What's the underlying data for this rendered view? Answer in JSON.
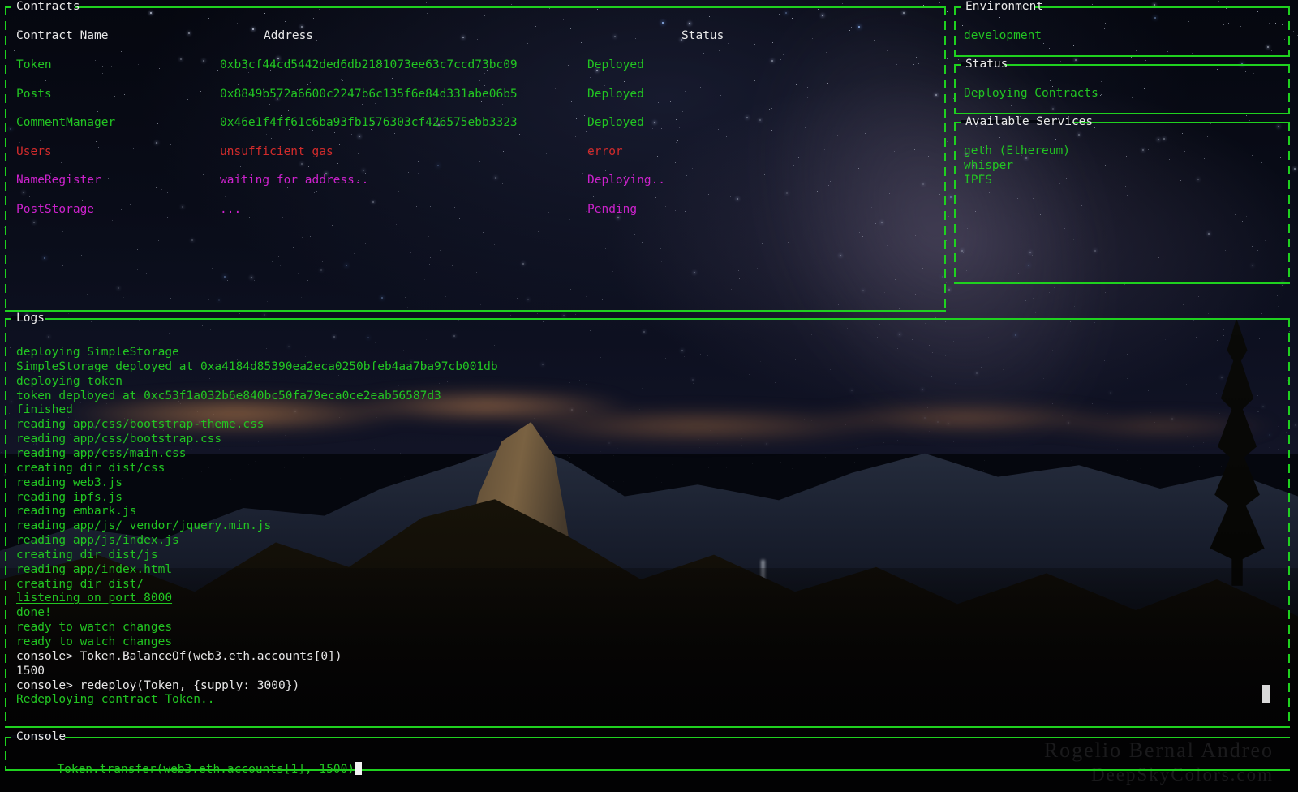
{
  "contracts_panel": {
    "title": "Contracts",
    "columns": [
      "Contract Name",
      "Address",
      "Status"
    ],
    "rows": [
      {
        "name": "Token",
        "address": "0xb3cf44cd5442ded6db2181073ee63c7ccd73bc09",
        "status": "Deployed",
        "color": "#22c522"
      },
      {
        "name": "Posts",
        "address": "0x8849b572a6600c2247b6c135f6e84d331abe06b5",
        "status": "Deployed",
        "color": "#22c522"
      },
      {
        "name": "CommentManager",
        "address": "0x46e1f4ff61c6ba93fb1576303cf426575ebb3323",
        "status": "Deployed",
        "color": "#22c522"
      },
      {
        "name": "Users",
        "address": "unsufficient gas",
        "status": "error",
        "color": "#d22b2b"
      },
      {
        "name": "NameRegister",
        "address": "waiting for address..",
        "status": "Deploying..",
        "color": "#cc22cc"
      },
      {
        "name": "PostStorage",
        "address": "...",
        "status": "Pending",
        "color": "#cc22cc"
      }
    ]
  },
  "environment_panel": {
    "title": "Environment",
    "value": "development"
  },
  "status_panel": {
    "title": "Status",
    "value": "Deploying Contracts"
  },
  "services_panel": {
    "title": "Available Services",
    "items": [
      "geth (Ethereum)",
      "whisper",
      "IPFS"
    ]
  },
  "logs_panel": {
    "title": "Logs",
    "lines": [
      {
        "text": "deploying SimpleStorage",
        "style": "g"
      },
      {
        "text": "SimpleStorage deployed at 0xa4184d85390ea2eca0250bfeb4aa7ba97cb001db",
        "style": "g"
      },
      {
        "text": "deploying token",
        "style": "g"
      },
      {
        "text": "token deployed at 0xc53f1a032b6e840bc50fa79eca0ce2eab56587d3",
        "style": "g"
      },
      {
        "text": "finished",
        "style": "g"
      },
      {
        "text": "reading app/css/bootstrap-theme.css",
        "style": "g"
      },
      {
        "text": "reading app/css/bootstrap.css",
        "style": "g"
      },
      {
        "text": "reading app/css/main.css",
        "style": "g"
      },
      {
        "text": "creating dir dist/css",
        "style": "g"
      },
      {
        "text": "reading web3.js",
        "style": "g"
      },
      {
        "text": "reading ipfs.js",
        "style": "g"
      },
      {
        "text": "reading embark.js",
        "style": "g"
      },
      {
        "text": "reading app/js/_vendor/jquery.min.js",
        "style": "g"
      },
      {
        "text": "reading app/js/index.js",
        "style": "g"
      },
      {
        "text": "creating dir dist/js",
        "style": "g"
      },
      {
        "text": "reading app/index.html",
        "style": "g"
      },
      {
        "text": "creating dir dist/",
        "style": "g"
      },
      {
        "text": "listening on port 8000",
        "style": "g u"
      },
      {
        "text": "done!",
        "style": "g"
      },
      {
        "text": "ready to watch changes",
        "style": "g"
      },
      {
        "text": "ready to watch changes",
        "style": "g"
      },
      {
        "text": "console> Token.BalanceOf(web3.eth.accounts[0])",
        "style": "w"
      },
      {
        "text": "1500",
        "style": "w"
      },
      {
        "text": "console> redeploy(Token, {supply: 3000})",
        "style": "w"
      },
      {
        "text": "Redeploying contract Token..",
        "style": "g"
      }
    ]
  },
  "console_panel": {
    "title": "Console",
    "input_value": "Token.transfer(web3.eth.accounts[1], 1500)"
  },
  "wallpaper": {
    "credit_line_1": "Rogelio Bernal Andreo",
    "credit_line_2": "DeepSkyColors.com"
  },
  "colors": {
    "border": "#1fd11f",
    "green": "#22c522",
    "white": "#e6e6e6",
    "red": "#d22b2b",
    "magenta": "#cc22cc",
    "background": "#05070f"
  }
}
